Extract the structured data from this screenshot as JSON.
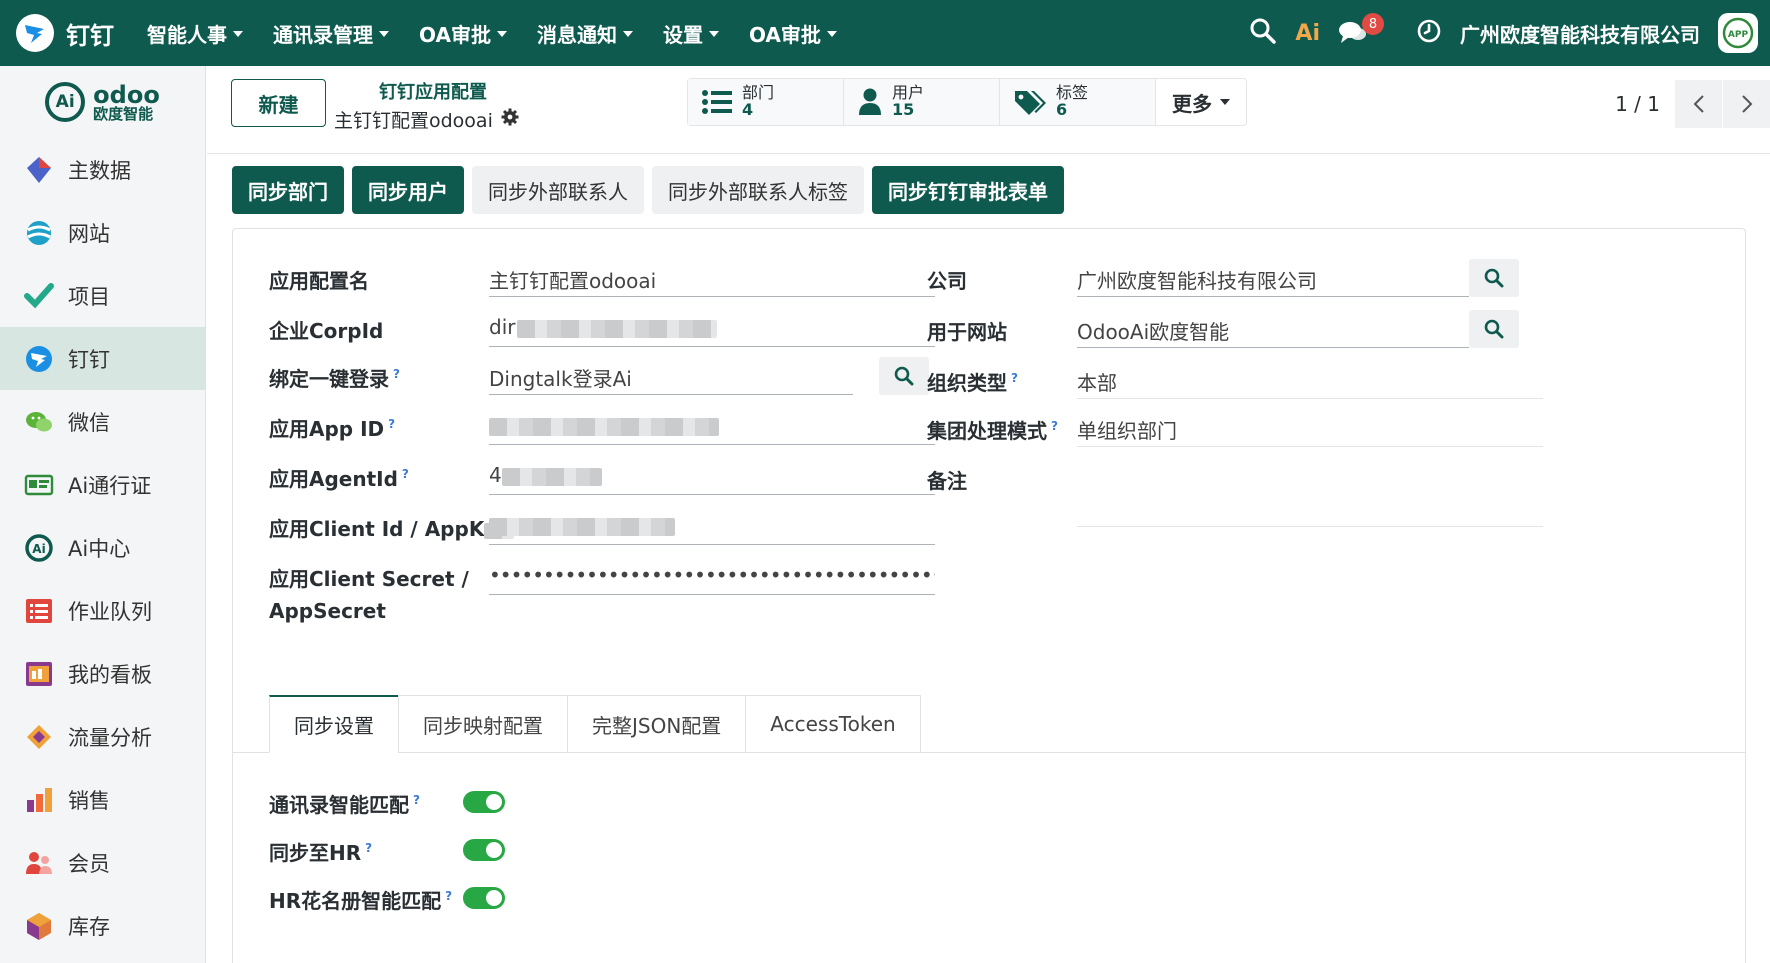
{
  "navbar": {
    "app_name": "钉钉",
    "menu": [
      "智能人事",
      "通讯录管理",
      "OA审批",
      "消息通知",
      "设置",
      "OA审批"
    ],
    "ai_logo": "Ai",
    "message_count": "8",
    "company": "广州欧度智能科技有限公司",
    "app_badge": "APP"
  },
  "sidebar": {
    "brand_mark": "Ai",
    "brand_name": "odoo",
    "brand_sub": "欧度智能",
    "items": [
      {
        "label": "主数据",
        "icon": "diamond-icon",
        "color": "#4b63c9"
      },
      {
        "label": "网站",
        "icon": "website-icon",
        "color": "#1fa0c9"
      },
      {
        "label": "项目",
        "icon": "check-icon",
        "color": "#23a98a"
      },
      {
        "label": "钉钉",
        "icon": "dingtalk-icon",
        "color": "#1a8fe3"
      },
      {
        "label": "微信",
        "icon": "wechat-icon",
        "color": "#5bb33a"
      },
      {
        "label": "Ai通行证",
        "icon": "sso-icon",
        "color": "#2f8a3a"
      },
      {
        "label": "Ai中心",
        "icon": "ai-center-icon",
        "color": "#0f5a4e"
      },
      {
        "label": "作业队列",
        "icon": "list-icon",
        "color": "#e0463d"
      },
      {
        "label": "我的看板",
        "icon": "dashboard-icon",
        "color": "#8a3a8e"
      },
      {
        "label": "流量分析",
        "icon": "analytics-icon",
        "color": "#f0a23a"
      },
      {
        "label": "销售",
        "icon": "sales-icon",
        "color": "#f06a3a"
      },
      {
        "label": "会员",
        "icon": "member-icon",
        "color": "#e0463d"
      },
      {
        "label": "库存",
        "icon": "inventory-icon",
        "color": "#e07a3a"
      }
    ]
  },
  "control": {
    "new_label": "新建",
    "breadcrumb_parent": "钉钉应用配置",
    "record_name": "主钉钉配置odooai",
    "stats": [
      {
        "label": "部门",
        "count": "4",
        "icon": "list-icon"
      },
      {
        "label": "用户",
        "count": "15",
        "icon": "user-icon"
      },
      {
        "label": "标签",
        "count": "6",
        "icon": "tags-icon"
      }
    ],
    "more_label": "更多",
    "pager": "1 / 1"
  },
  "actions": [
    {
      "label": "同步部门",
      "primary": true
    },
    {
      "label": "同步用户",
      "primary": true
    },
    {
      "label": "同步外部联系人",
      "primary": false
    },
    {
      "label": "同步外部联系人标签",
      "primary": false
    },
    {
      "label": "同步钉钉审批表单",
      "primary": true
    }
  ],
  "form": {
    "left": [
      {
        "label": "应用配置名",
        "value": "主钉钉配置odooai",
        "help": ""
      },
      {
        "label": "企业CorpId",
        "value": "dir",
        "help": ""
      },
      {
        "label": "绑定一键登录",
        "value": "Dingtalk登录Ai",
        "help": "?"
      },
      {
        "label": "应用App ID",
        "value": "",
        "help": "?"
      },
      {
        "label": "应用AgentId",
        "value": "4",
        "help": "?"
      },
      {
        "label": "应用Client Id / AppK",
        "value": "",
        "help": ""
      },
      {
        "label": "应用Client Secret /",
        "label2": "AppSecret",
        "value": "•••••••••••••••••••••••••••••••••••••••••••",
        "help": ""
      }
    ],
    "right": [
      {
        "label": "公司",
        "value": "广州欧度智能科技有限公司",
        "help": ""
      },
      {
        "label": "用于网站",
        "value": "OdooAi欧度智能",
        "help": ""
      },
      {
        "label": "组织类型",
        "value": "本部",
        "help": "?"
      },
      {
        "label": "集团处理模式",
        "value": "单组织部门",
        "help": "?"
      },
      {
        "label": "备注",
        "value": "",
        "help": ""
      }
    ]
  },
  "tabs": [
    "同步设置",
    "同步映射配置",
    "完整JSON配置",
    "AccessToken"
  ],
  "toggles": [
    {
      "label": "通讯录智能匹配",
      "help": "?",
      "on": true
    },
    {
      "label": "同步至HR",
      "help": "?",
      "on": true
    },
    {
      "label": "HR花名册智能匹配",
      "help": "?",
      "on": true
    }
  ],
  "colors": {
    "brand": "#0f5a4e",
    "toggle_on": "#28a745",
    "badge": "#e24b43"
  }
}
